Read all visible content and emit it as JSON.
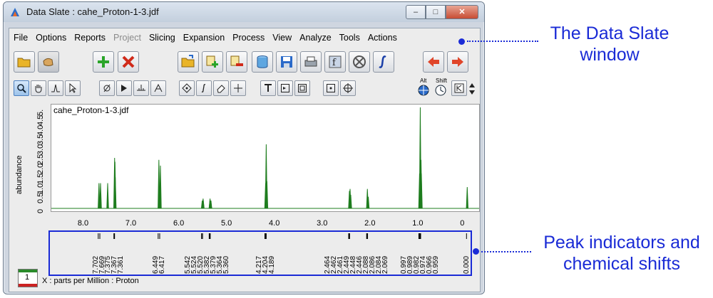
{
  "window": {
    "title": "Data Slate : cahe_Proton-1-3.jdf",
    "controls": {
      "minimize": "‒",
      "maximize": "□",
      "close": "✕"
    }
  },
  "menu": [
    {
      "label": "File",
      "enabled": true
    },
    {
      "label": "Options",
      "enabled": true
    },
    {
      "label": "Reports",
      "enabled": true
    },
    {
      "label": "Project",
      "enabled": false
    },
    {
      "label": "Slicing",
      "enabled": true
    },
    {
      "label": "Expansion",
      "enabled": true
    },
    {
      "label": "Process",
      "enabled": true
    },
    {
      "label": "View",
      "enabled": true
    },
    {
      "label": "Analyze",
      "enabled": true
    },
    {
      "label": "Tools",
      "enabled": true
    },
    {
      "label": "Actions",
      "enabled": true
    }
  ],
  "toolbar_icons": {
    "row1": [
      "folder-open-icon",
      "hand-pointer-icon",
      "add-icon",
      "delete-icon",
      "open-file-icon",
      "add-layer-icon",
      "remove-layer-icon",
      "cylinder-icon",
      "save-icon",
      "print-icon",
      "formula-icon",
      "stop-icon",
      "integral-icon",
      "arrow-left-icon",
      "arrow-right-icon"
    ],
    "row2": [
      "zoom-icon",
      "pan-icon",
      "peak-icon",
      "pointer-icon",
      "phase-icon",
      "play-icon",
      "baseline-icon",
      "peak-pick-icon",
      "diamond-icon",
      "integral-small-icon",
      "eraser-icon",
      "crosshair-icon",
      "text-icon",
      "frame-icon",
      "square-icon",
      "point-icon",
      "target-icon",
      "alt-target-icon",
      "shift-clock-icon",
      "k-icon",
      "spinner-icon"
    ],
    "modifier_labels": {
      "alt": "Alt",
      "shift": "Shift"
    }
  },
  "spectrum": {
    "filename": "cahe_Proton-1-3.jdf",
    "y_axis_label": "abundance",
    "y_ticks": [
      "0",
      "0.5",
      "1.0",
      "1.5",
      "2.0",
      "2.5",
      "3.0",
      "3.5",
      "4.0",
      "4.5",
      "5."
    ],
    "x_ticks": [
      "8.0",
      "7.0",
      "6.0",
      "5.0",
      "4.0",
      "3.0",
      "2.0",
      "1.0",
      "0"
    ],
    "x_axis_label": "X : parts per Million : Proton",
    "status_value": "1"
  },
  "chart_data": {
    "type": "line",
    "x_range": [
      8.4,
      -0.1
    ],
    "y_range": [
      0,
      5.2
    ],
    "xlabel": "X : parts per Million : Proton",
    "ylabel": "abundance",
    "peaks": [
      {
        "ppm": 7.702,
        "height": 1.3
      },
      {
        "ppm": 7.669,
        "height": 1.3
      },
      {
        "ppm": 7.52,
        "height": 1.3
      },
      {
        "ppm": 7.375,
        "height": 2.6
      },
      {
        "ppm": 7.367,
        "height": 2.4
      },
      {
        "ppm": 7.361,
        "height": 1.6
      },
      {
        "ppm": 6.449,
        "height": 2.5
      },
      {
        "ppm": 6.417,
        "height": 2.2
      },
      {
        "ppm": 5.542,
        "height": 0.4
      },
      {
        "ppm": 5.524,
        "height": 0.5
      },
      {
        "ppm": 5.52,
        "height": 0.4
      },
      {
        "ppm": 5.382,
        "height": 0.4
      },
      {
        "ppm": 5.379,
        "height": 0.5
      },
      {
        "ppm": 5.364,
        "height": 0.4
      },
      {
        "ppm": 5.36,
        "height": 0.4
      },
      {
        "ppm": 4.217,
        "height": 1.3
      },
      {
        "ppm": 4.204,
        "height": 3.3
      },
      {
        "ppm": 4.189,
        "height": 1.4
      },
      {
        "ppm": 2.464,
        "height": 0.9
      },
      {
        "ppm": 2.45,
        "height": 1.0
      },
      {
        "ppm": 2.436,
        "height": 0.7
      },
      {
        "ppm": 2.088,
        "height": 1.0
      },
      {
        "ppm": 2.069,
        "height": 0.6
      },
      {
        "ppm": 0.997,
        "height": 1.8
      },
      {
        "ppm": 0.982,
        "height": 5.2
      },
      {
        "ppm": 0.966,
        "height": 2.5
      },
      {
        "ppm": 0.959,
        "height": 1.8
      },
      {
        "ppm": 0.0,
        "height": 1.1
      }
    ]
  },
  "peak_labels": [
    "7.702",
    "7.669",
    "7.375",
    "7.367",
    "7.361",
    "6.449",
    "6.417",
    "5.542",
    "5.524",
    "5.520",
    "5.382",
    "5.379",
    "5.364",
    "5.360",
    "4.217",
    "4.204",
    "4.189",
    "2.464",
    "2.462",
    "2.461",
    "2.449",
    "2.448",
    "2.446",
    "2.088",
    "2.086",
    "2.084",
    "2.069",
    "0.997",
    "0.989",
    "0.982",
    "0.974",
    "0.966",
    "0.959",
    "0.000"
  ],
  "callouts": {
    "window": "The Data Slate window",
    "peaks": "Peak indicators and chemical shifts"
  },
  "colors": {
    "accent_blue": "#1a2bd6",
    "trace": "#1e7d1e"
  }
}
